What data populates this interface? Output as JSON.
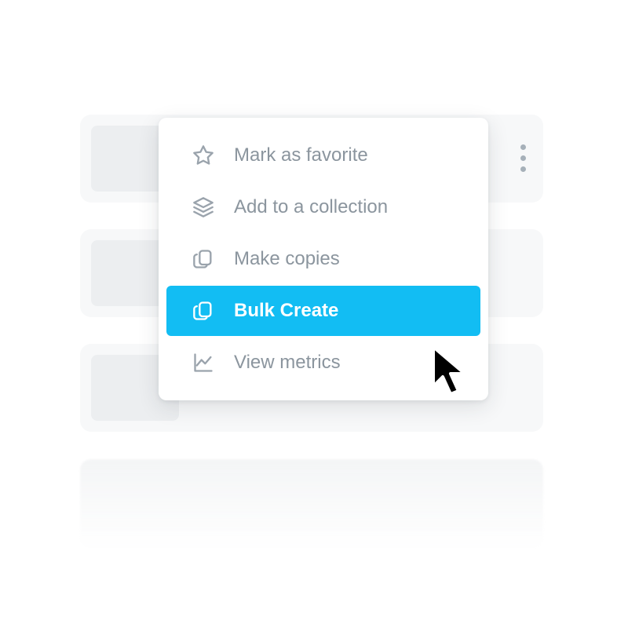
{
  "colors": {
    "highlight": "#12bdf3",
    "muted_text": "#8b959e",
    "icon": "#9aa3ac",
    "card_bg": "#f7f8f9",
    "thumb_bg": "#eceef0"
  },
  "background_items": 3,
  "menu": {
    "items": [
      {
        "icon": "star-icon",
        "label": "Mark as favorite"
      },
      {
        "icon": "layers-icon",
        "label": "Add to a collection"
      },
      {
        "icon": "copy-icon",
        "label": "Make copies"
      },
      {
        "icon": "copy-icon",
        "label": "Bulk Create",
        "active": true
      },
      {
        "icon": "chart-icon",
        "label": "View metrics"
      }
    ]
  }
}
